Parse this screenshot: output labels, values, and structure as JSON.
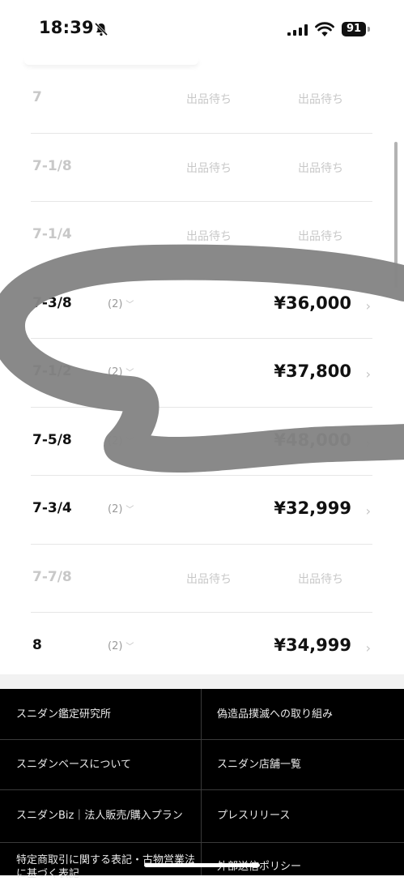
{
  "status_bar": {
    "time": "18:39",
    "battery": "91",
    "icons": [
      "bell-slash-icon",
      "signal-icon",
      "wifi-icon",
      "battery-icon"
    ]
  },
  "size_rows": [
    {
      "size": "7",
      "status_a": "出品待ち",
      "status_b": "出品待ち",
      "pending": true
    },
    {
      "size": "7-1/8",
      "status_a": "出品待ち",
      "status_b": "出品待ち",
      "pending": true
    },
    {
      "size": "7-1/4",
      "status_a": "出品待ち",
      "status_b": "出品待ち",
      "pending": true
    },
    {
      "size": "7-3/8",
      "count": "(2)",
      "price": "¥36,000",
      "pending": false
    },
    {
      "size": "7-1/2",
      "count": "(2)",
      "price": "¥37,800",
      "pending": false
    },
    {
      "size": "7-5/8",
      "count": "(2)",
      "price": "¥48,000",
      "pending": false
    },
    {
      "size": "7-3/4",
      "count": "(2)",
      "price": "¥32,999",
      "pending": false
    },
    {
      "size": "7-7/8",
      "status_a": "出品待ち",
      "status_b": "出品待ち",
      "pending": true
    },
    {
      "size": "8",
      "count": "(2)",
      "price": "¥34,999",
      "pending": false
    }
  ],
  "footer": {
    "links": [
      "スニダン鑑定研究所",
      "偽造品撲滅への取り組み",
      "スニダンベースについて",
      "スニダン店舗一覧",
      "スニダンBiz｜法人販売/購入プラン",
      "プレスリリース",
      "特定商取引に関する表記・古物営業法に基づく表記",
      "外部送信ポリシー"
    ]
  },
  "colors": {
    "accent_text": "#111111",
    "muted_text": "#c8c8c8",
    "footer_bg": "#000000",
    "scribble": "#8a8a8a"
  }
}
